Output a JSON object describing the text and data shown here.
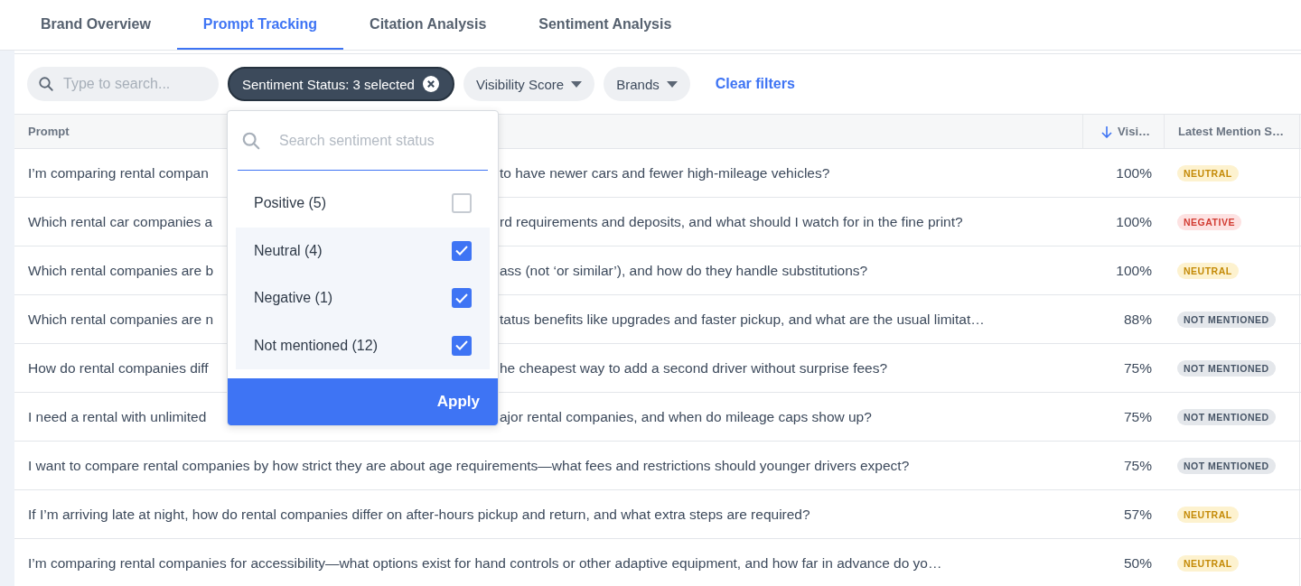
{
  "tabs": [
    {
      "label": "Brand Overview",
      "selected": false
    },
    {
      "label": "Prompt Tracking",
      "selected": true
    },
    {
      "label": "Citation Analysis",
      "selected": false
    },
    {
      "label": "Sentiment Analysis",
      "selected": false
    }
  ],
  "filters": {
    "search": {
      "placeholder": "Type to search..."
    },
    "chips": [
      {
        "label": "Sentiment Status: 3 selected",
        "kind": "active"
      },
      {
        "label": "Visibility Score",
        "kind": "dropdown"
      },
      {
        "label": "Brands",
        "kind": "dropdown"
      }
    ],
    "clear": "Clear filters"
  },
  "dropdown": {
    "search": {
      "placeholder": "Search sentiment status"
    },
    "options": [
      {
        "label": "Positive (5)",
        "checked": false
      },
      {
        "label": "Neutral (4)",
        "checked": true
      },
      {
        "label": "Negative (1)",
        "checked": true
      },
      {
        "label": "Not mentioned (12)",
        "checked": true
      }
    ],
    "apply": "Apply"
  },
  "table": {
    "columns": [
      {
        "label": "Prompt",
        "sorted": false
      },
      {
        "label": "Visi…",
        "sorted": true
      },
      {
        "label": "Latest Mention S…",
        "sorted": false
      }
    ],
    "rows": [
      {
        "prompt": [
          "I’m comparing rental compan",
          "to have newer cars and fewer high-mileage vehicles?"
        ],
        "visibility": "100%",
        "status": {
          "label": "NEUTRAL",
          "kind": "neutral"
        }
      },
      {
        "prompt": [
          "Which rental car companies a",
          "rd requirements and deposits, and what should I watch for in the fine print?"
        ],
        "visibility": "100%",
        "status": {
          "label": "NEGATIVE",
          "kind": "negative"
        }
      },
      {
        "prompt": [
          "Which rental companies are b",
          "ass (not ‘or similar’), and how do they handle substitutions?"
        ],
        "visibility": "100%",
        "status": {
          "label": "NEUTRAL",
          "kind": "neutral"
        }
      },
      {
        "prompt": [
          "Which rental companies are n",
          "tatus benefits like upgrades and faster pickup, and what are the usual limitat…"
        ],
        "visibility": "88%",
        "status": {
          "label": "NOT MENTIONED",
          "kind": "not_mentioned"
        }
      },
      {
        "prompt": [
          "How do rental companies diff",
          "he cheapest way to add a second driver without surprise fees?"
        ],
        "visibility": "75%",
        "status": {
          "label": "NOT MENTIONED",
          "kind": "not_mentioned"
        }
      },
      {
        "prompt": [
          "I need a rental with unlimited",
          "ajor rental companies, and when do mileage caps show up?"
        ],
        "visibility": "75%",
        "status": {
          "label": "NOT MENTIONED",
          "kind": "not_mentioned"
        }
      },
      {
        "prompt": [
          "I want to compare rental companies by how strict they are about age requirements—what fees and restrictions should younger drivers expect?"
        ],
        "visibility": "75%",
        "status": {
          "label": "NOT MENTIONED",
          "kind": "not_mentioned"
        }
      },
      {
        "prompt": [
          "If I’m arriving late at night, how do rental companies differ on after-hours pickup and return, and what extra steps are required?"
        ],
        "visibility": "57%",
        "status": {
          "label": "NEUTRAL",
          "kind": "neutral"
        }
      },
      {
        "prompt": [
          "I’m comparing rental companies for accessibility—what options exist for hand controls or other adaptive equipment, and how far in advance do yo…"
        ],
        "visibility": "50%",
        "status": {
          "label": "NEUTRAL",
          "kind": "neutral"
        }
      }
    ]
  }
}
